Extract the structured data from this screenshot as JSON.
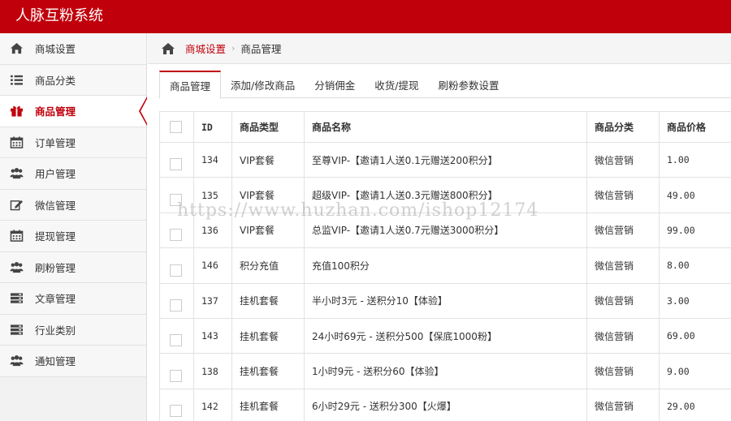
{
  "app": {
    "title": "人脉互粉系统"
  },
  "sidebar": {
    "items": [
      {
        "label": "商城设置",
        "icon": "home-icon"
      },
      {
        "label": "商品分类",
        "icon": "list-icon"
      },
      {
        "label": "商品管理",
        "icon": "gift-icon",
        "active": true
      },
      {
        "label": "订单管理",
        "icon": "calendar-icon"
      },
      {
        "label": "用户管理",
        "icon": "users-icon"
      },
      {
        "label": "微信管理",
        "icon": "edit-icon"
      },
      {
        "label": "提现管理",
        "icon": "calendar-icon"
      },
      {
        "label": "刷粉管理",
        "icon": "users-icon"
      },
      {
        "label": "文章管理",
        "icon": "server-icon"
      },
      {
        "label": "行业类别",
        "icon": "server-icon"
      },
      {
        "label": "通知管理",
        "icon": "users-icon"
      }
    ]
  },
  "breadcrumb": {
    "link": "商城设置",
    "separator": "›",
    "current": "商品管理"
  },
  "tabs": [
    {
      "label": "商品管理",
      "active": true
    },
    {
      "label": "添加/修改商品"
    },
    {
      "label": "分销佣金"
    },
    {
      "label": "收货/提现"
    },
    {
      "label": "刷粉参数设置"
    }
  ],
  "table": {
    "headers": [
      "ID",
      "商品类型",
      "商品名称",
      "商品分类",
      "商品价格"
    ],
    "rows": [
      [
        "134",
        "VIP套餐",
        "至尊VIP-【邀请1人送0.1元赠送200积分】",
        "微信营销",
        "1.00"
      ],
      [
        "135",
        "VIP套餐",
        "超级VIP-【邀请1人送0.3元赠送800积分】",
        "微信营销",
        "49.00"
      ],
      [
        "136",
        "VIP套餐",
        "总监VIP-【邀请1人送0.7元赠送3000积分】",
        "微信营销",
        "99.00"
      ],
      [
        "146",
        "积分充值",
        "充值100积分",
        "微信营销",
        "8.00"
      ],
      [
        "137",
        "挂机套餐",
        "半小时3元 - 送积分10【体验】",
        "微信营销",
        "3.00"
      ],
      [
        "143",
        "挂机套餐",
        "24小时69元 - 送积分500【保底1000粉】",
        "微信营销",
        "69.00"
      ],
      [
        "138",
        "挂机套餐",
        "1小时9元 - 送积分60【体验】",
        "微信营销",
        "9.00"
      ],
      [
        "142",
        "挂机套餐",
        "6小时29元 - 送积分300【火爆】",
        "微信营销",
        "29.00"
      ]
    ]
  },
  "watermark": "https://www.huzhan.com/ishop12174",
  "colors": {
    "accent": "#c0000b",
    "icon": "#444444"
  }
}
